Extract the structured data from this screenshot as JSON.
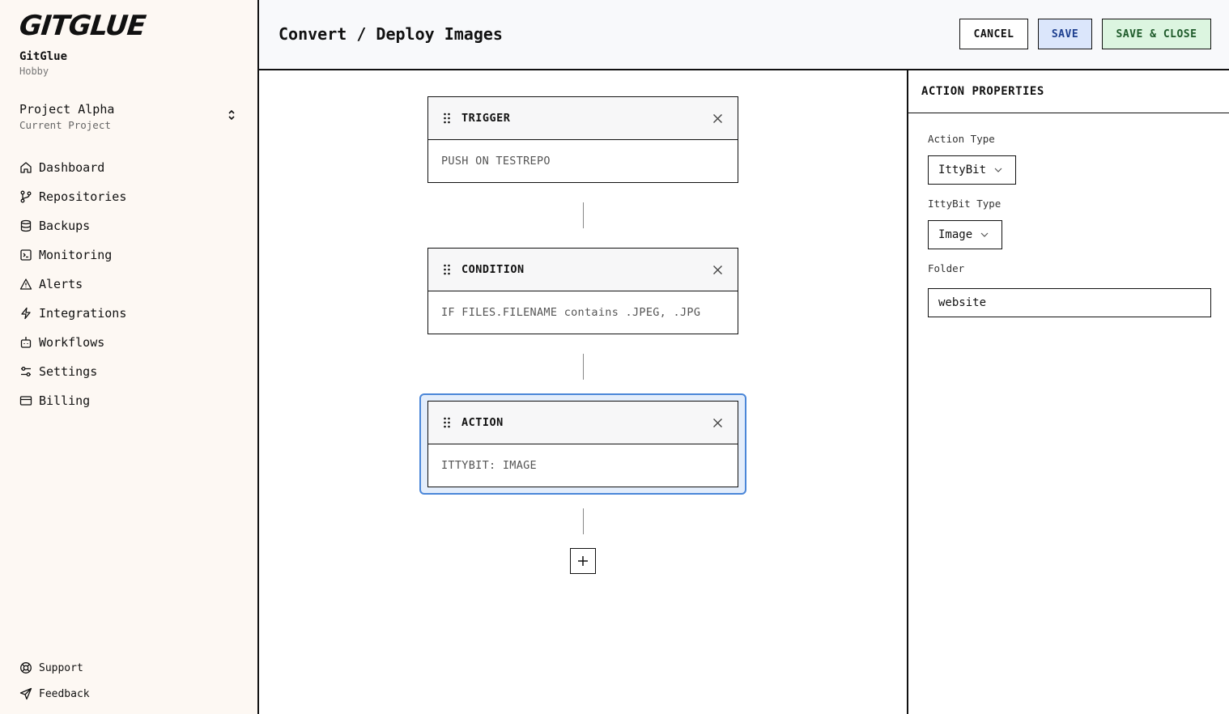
{
  "brand": {
    "logo": "GITGLUE",
    "org_name": "GitGlue",
    "plan": "Hobby"
  },
  "project": {
    "name": "Project Alpha",
    "subtitle": "Current Project"
  },
  "nav": {
    "items": [
      {
        "label": "Dashboard",
        "icon": "home-icon"
      },
      {
        "label": "Repositories",
        "icon": "git-branch-icon"
      },
      {
        "label": "Backups",
        "icon": "database-icon"
      },
      {
        "label": "Monitoring",
        "icon": "terminal-icon"
      },
      {
        "label": "Alerts",
        "icon": "alert-triangle-icon"
      },
      {
        "label": "Integrations",
        "icon": "bolt-icon"
      },
      {
        "label": "Workflows",
        "icon": "robot-icon"
      },
      {
        "label": "Settings",
        "icon": "sliders-icon"
      },
      {
        "label": "Billing",
        "icon": "credit-card-icon"
      }
    ],
    "bottom": [
      {
        "label": "Support",
        "icon": "lifebuoy-icon"
      },
      {
        "label": "Feedback",
        "icon": "send-icon"
      }
    ]
  },
  "header": {
    "title": "Convert / Deploy Images",
    "cancel_label": "CANCEL",
    "save_label": "SAVE",
    "save_close_label": "SAVE & CLOSE"
  },
  "workflow": {
    "steps": [
      {
        "title": "TRIGGER",
        "body": "PUSH ON TESTREPO"
      },
      {
        "title": "CONDITION",
        "body": "IF FILES.FILENAME contains .JPEG, .JPG"
      },
      {
        "title": "ACTION",
        "body": "ITTYBIT: IMAGE",
        "selected": true
      }
    ]
  },
  "properties": {
    "title": "ACTION PROPERTIES",
    "action_type_label": "Action Type",
    "action_type_value": "IttyBit",
    "ittybit_type_label": "IttyBit Type",
    "ittybit_type_value": "Image",
    "folder_label": "Folder",
    "folder_value": "website"
  },
  "colors": {
    "sidebar_bg": "#fdf8f3",
    "selected_border": "#4a86d8",
    "save_bg": "#dbe6fb",
    "save_close_bg": "#dcf5e0"
  }
}
